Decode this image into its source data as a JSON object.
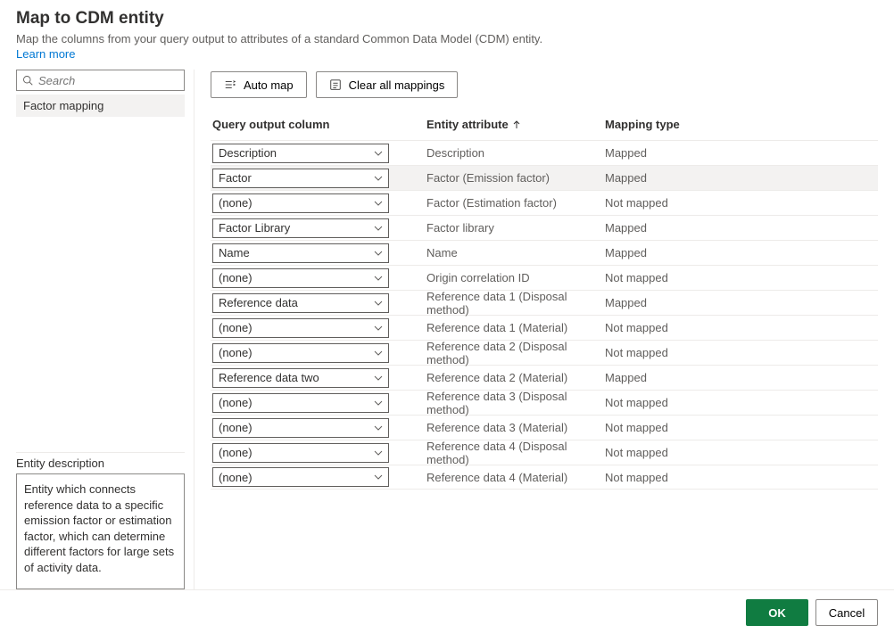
{
  "header": {
    "title": "Map to CDM entity",
    "subtitle": "Map the columns from your query output to attributes of a standard Common Data Model (CDM) entity.",
    "learn_more": "Learn more"
  },
  "sidebar": {
    "search_placeholder": "Search",
    "items": [
      {
        "label": "Factor mapping"
      }
    ],
    "description_label": "Entity description",
    "description_text": "Entity which connects reference data to a specific emission factor or estimation factor, which can determine different factors for large sets of activity data."
  },
  "toolbar": {
    "auto_map": "Auto map",
    "clear_all": "Clear all mappings"
  },
  "table": {
    "headers": {
      "query_output": "Query output column",
      "entity_attr": "Entity attribute",
      "mapping_type": "Mapping type"
    },
    "rows": [
      {
        "query": "Description",
        "attr": "Description",
        "type": "Mapped",
        "selected": false
      },
      {
        "query": "Factor",
        "attr": "Factor (Emission factor)",
        "type": "Mapped",
        "selected": true
      },
      {
        "query": "(none)",
        "attr": "Factor (Estimation factor)",
        "type": "Not mapped",
        "selected": false
      },
      {
        "query": "Factor Library",
        "attr": "Factor library",
        "type": "Mapped",
        "selected": false
      },
      {
        "query": "Name",
        "attr": "Name",
        "type": "Mapped",
        "selected": false
      },
      {
        "query": "(none)",
        "attr": "Origin correlation ID",
        "type": "Not mapped",
        "selected": false
      },
      {
        "query": "Reference data",
        "attr": "Reference data 1 (Disposal method)",
        "type": "Mapped",
        "selected": false
      },
      {
        "query": "(none)",
        "attr": "Reference data 1 (Material)",
        "type": "Not mapped",
        "selected": false
      },
      {
        "query": "(none)",
        "attr": "Reference data 2 (Disposal method)",
        "type": "Not mapped",
        "selected": false
      },
      {
        "query": "Reference data two",
        "attr": "Reference data 2 (Material)",
        "type": "Mapped",
        "selected": false
      },
      {
        "query": "(none)",
        "attr": "Reference data 3 (Disposal method)",
        "type": "Not mapped",
        "selected": false
      },
      {
        "query": "(none)",
        "attr": "Reference data 3 (Material)",
        "type": "Not mapped",
        "selected": false
      },
      {
        "query": "(none)",
        "attr": "Reference data 4 (Disposal method)",
        "type": "Not mapped",
        "selected": false
      },
      {
        "query": "(none)",
        "attr": "Reference data 4 (Material)",
        "type": "Not mapped",
        "selected": false
      }
    ]
  },
  "footer": {
    "ok": "OK",
    "cancel": "Cancel"
  }
}
